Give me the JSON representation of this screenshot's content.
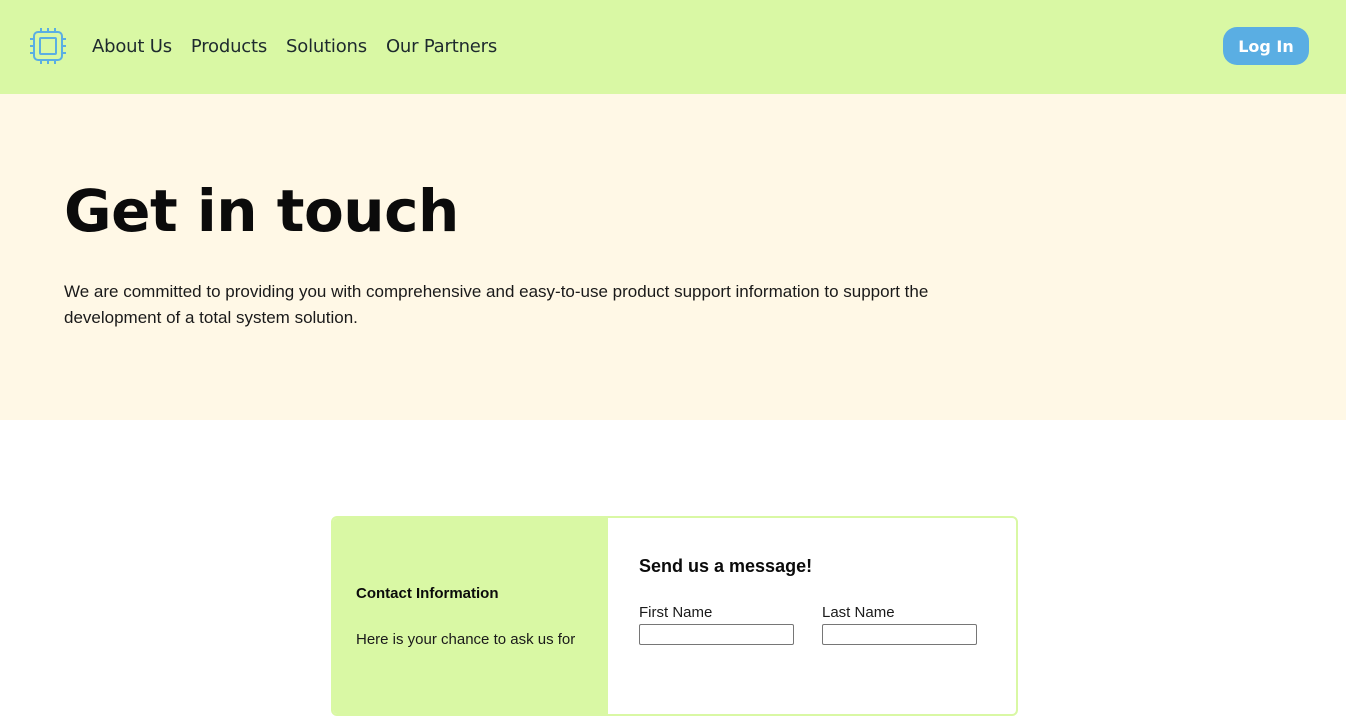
{
  "nav": {
    "logo_icon": "chip-icon",
    "links": [
      "About Us",
      "Products",
      "Solutions",
      "Our Partners"
    ],
    "login_label": "Log In"
  },
  "hero": {
    "title": "Get in touch",
    "text": "We are committed to providing you with comprehensive and easy-to-use product support information to support the development of a total system solution."
  },
  "contact": {
    "info_title": "Contact Information",
    "info_text": "Here is your chance to ask us for",
    "message_title": "Send us a message!",
    "first_name_label": "First Name",
    "first_name_value": "",
    "last_name_label": "Last Name",
    "last_name_value": ""
  },
  "colors": {
    "nav_bg": "#d9f8a4",
    "hero_bg": "#fff8e6",
    "accent": "#5aaee3"
  }
}
